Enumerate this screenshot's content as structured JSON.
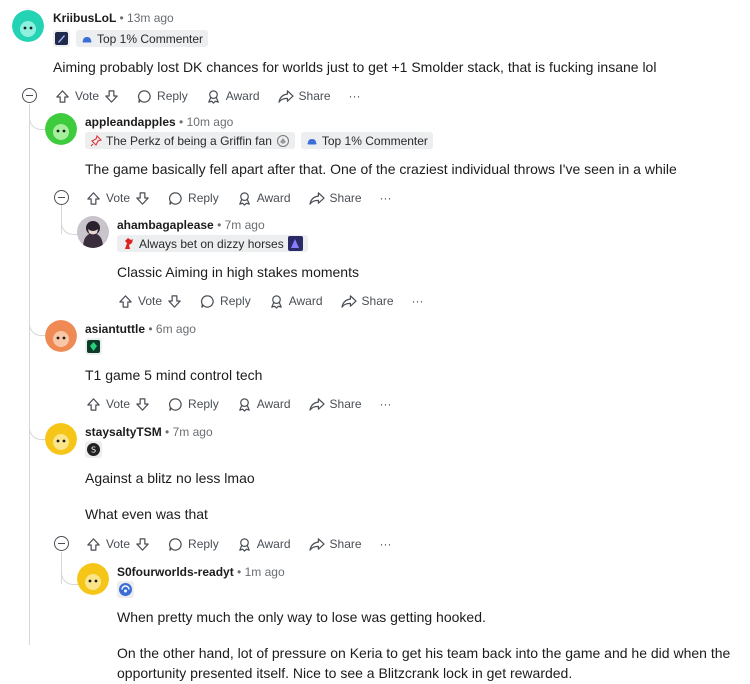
{
  "actions": {
    "vote": "Vote",
    "reply": "Reply",
    "award": "Award",
    "share": "Share",
    "more": "···"
  },
  "comments": [
    {
      "username": "KriibusLoL",
      "time": "13m ago",
      "flairs": [
        "Top 1% Commenter"
      ],
      "body": [
        "Aiming probably lost DK chances for worlds just to get +1 Smolder stack, that is fucking insane lol"
      ],
      "avatar_color": "#24d3b4"
    },
    {
      "username": "appleandapples",
      "time": "10m ago",
      "flairs": [
        "The Perkz of being a Griffin fan",
        "Top 1% Commenter"
      ],
      "body": [
        "The game basically fell apart after that. One of the craziest individual throws I've seen in a while"
      ],
      "avatar_color": "#3ecb3e"
    },
    {
      "username": "ahambagaplease",
      "time": "7m ago",
      "flairs": [
        "Always bet on dizzy horses"
      ],
      "body": [
        "Classic Aiming in high stakes moments"
      ],
      "avatar_color": "#4a3f4a"
    },
    {
      "username": "asiantuttle",
      "time": "6m ago",
      "flairs": [],
      "body": [
        "T1 game 5 mind control tech"
      ],
      "avatar_color": "#f08a54"
    },
    {
      "username": "staysaltyTSM",
      "time": "7m ago",
      "flairs": [],
      "body": [
        "Against a blitz no less lmao",
        "What even was that"
      ],
      "avatar_color": "#f5c518"
    },
    {
      "username": "S0fourworlds-readyt",
      "time": "1m ago",
      "flairs": [],
      "body": [
        "When pretty much the only way to lose was getting hooked.",
        "On the other hand, lot of pressure on Keria to get his team back into the game and he did when the opportunity presented itself. Nice to see a Blitzcrank lock in get rewarded."
      ],
      "avatar_color": "#f5c518"
    }
  ]
}
